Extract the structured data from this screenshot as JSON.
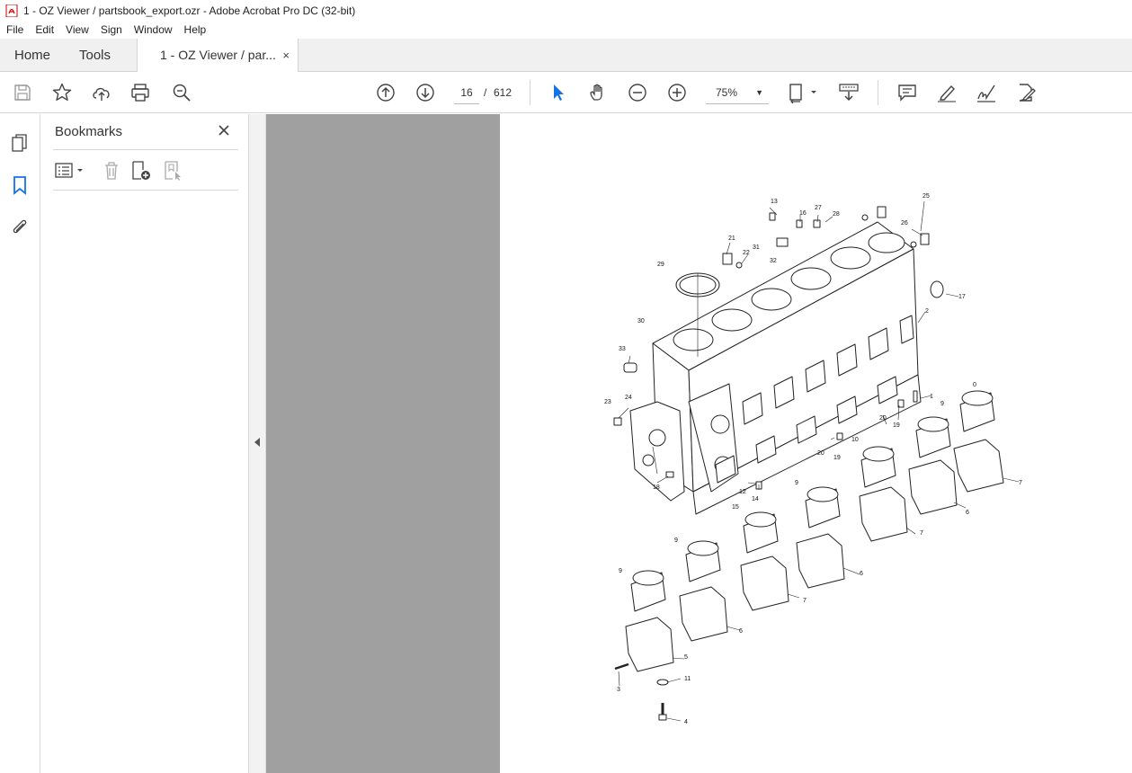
{
  "window": {
    "title": "1 - OZ Viewer / partsbook_export.ozr - Adobe Acrobat Pro DC (32-bit)"
  },
  "menu": [
    "File",
    "Edit",
    "View",
    "Sign",
    "Window",
    "Help"
  ],
  "tabs": {
    "home": "Home",
    "tools": "Tools",
    "document": "1 - OZ Viewer / par...",
    "close_symbol": "×"
  },
  "toolbar": {
    "current_page": "16",
    "page_separator": "/",
    "total_pages": "612",
    "zoom": "75%",
    "zoom_caret": "▼"
  },
  "icons": {
    "toolbar": [
      "save-icon",
      "bookmark-star-icon",
      "upload-cloud-icon",
      "print-icon",
      "zoom-search-icon",
      "page-up-icon",
      "page-down-icon",
      "select-pointer-icon",
      "hand-pan-icon",
      "zoom-out-icon",
      "zoom-in-icon",
      "page-fit-icon",
      "scroll-mode-icon",
      "comment-icon",
      "highlight-pen-icon",
      "sign-icon",
      "edit-document-icon"
    ],
    "rail": [
      "pages-icon",
      "bookmarks-icon",
      "attachments-icon"
    ]
  },
  "bookmarks_panel": {
    "title": "Bookmarks"
  },
  "accent_color": "#1473e6",
  "drawing": {
    "callouts": [
      "13",
      "16",
      "27",
      "28",
      "25",
      "26",
      "21",
      "31",
      "22",
      "32",
      "29",
      "17",
      "30",
      "2",
      "33",
      "1",
      "0",
      "23",
      "24",
      "20",
      "19",
      "9",
      "10",
      "20",
      "19",
      "7",
      "18",
      "12",
      "14",
      "9",
      "6",
      "15",
      "7",
      "9",
      "6",
      "9",
      "7",
      "6",
      "5",
      "3",
      "11",
      "4"
    ]
  }
}
